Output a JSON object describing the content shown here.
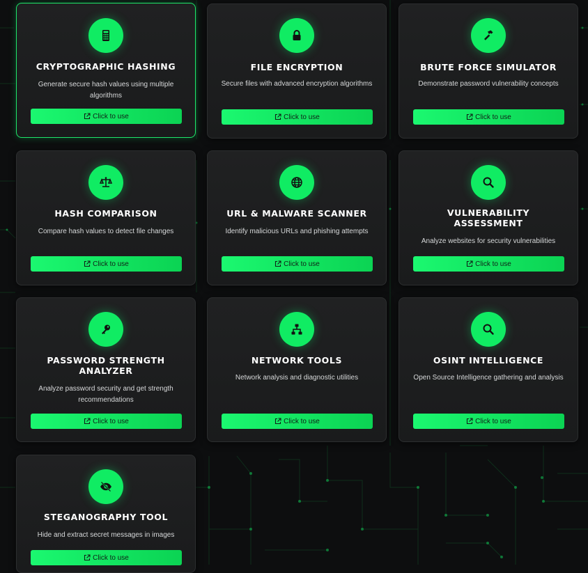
{
  "theme": {
    "accent": "#10ec63",
    "card_bg": "#1e1f20",
    "page_bg": "#0d0e0f",
    "active_border": "#1ee86a"
  },
  "button_icon": "external-link-icon",
  "tools": [
    {
      "title": "Cryptographic Hashing",
      "description": "Generate secure hash values using multiple algorithms",
      "button_label": "Click to use",
      "icon": "calculator-icon"
    },
    {
      "title": "File Encryption",
      "description": "Secure files with advanced encryption algorithms",
      "button_label": "Click to use",
      "icon": "lock-icon"
    },
    {
      "title": "Brute Force Simulator",
      "description": "Demonstrate password vulnerability concepts",
      "button_label": "Click to use",
      "icon": "hammer-icon"
    },
    {
      "title": "Hash Comparison",
      "description": "Compare hash values to detect file changes",
      "button_label": "Click to use",
      "icon": "scale-icon"
    },
    {
      "title": "URL & Malware Scanner",
      "description": "Identify malicious URLs and phishing attempts",
      "button_label": "Click to use",
      "icon": "globe-icon"
    },
    {
      "title": "Vulnerability Assessment",
      "description": "Analyze websites for security vulnerabilities",
      "button_label": "Click to use",
      "icon": "search-icon"
    },
    {
      "title": "Password Strength Analyzer",
      "description": "Analyze password security and get strength recommendations",
      "button_label": "Click to use",
      "icon": "key-icon"
    },
    {
      "title": "Network Tools",
      "description": "Network analysis and diagnostic utilities",
      "button_label": "Click to use",
      "icon": "network-icon"
    },
    {
      "title": "OSINT Intelligence",
      "description": "Open Source Intelligence gathering and analysis",
      "button_label": "Click to use",
      "icon": "search-icon"
    },
    {
      "title": "Steganography Tool",
      "description": "Hide and extract secret messages in images",
      "button_label": "Click to use",
      "icon": "eye-slash-icon"
    }
  ]
}
